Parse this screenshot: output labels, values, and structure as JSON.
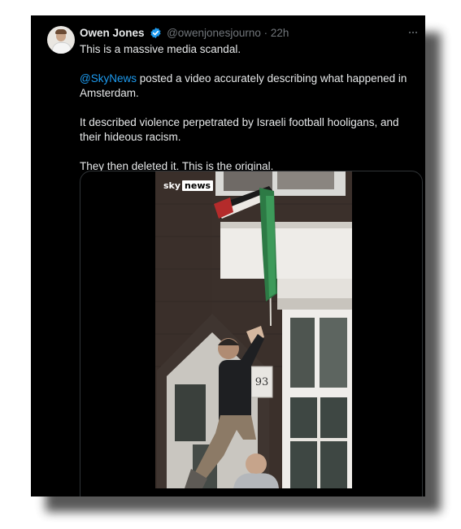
{
  "tweet": {
    "author_name": "Owen Jones",
    "handle": "@owenjonesjourno",
    "separator": "·",
    "time": "22h",
    "line1": "This is a massive media scandal.",
    "mention": "@SkyNews",
    "line2_rest": " posted a video accurately describing what happened in Amsterdam.",
    "line3": "It described violence perpetrated by Israeli football hooligans, and their hideous racism.",
    "line4": "They then deleted it. This is the original."
  },
  "video": {
    "logo_sky": "sky",
    "logo_news": "news",
    "house_number": "93"
  },
  "colors": {
    "background": "#000000",
    "text": "#e7e9ea",
    "muted": "#71767b",
    "link": "#1d9bf0",
    "verified": "#1d9bf0"
  }
}
